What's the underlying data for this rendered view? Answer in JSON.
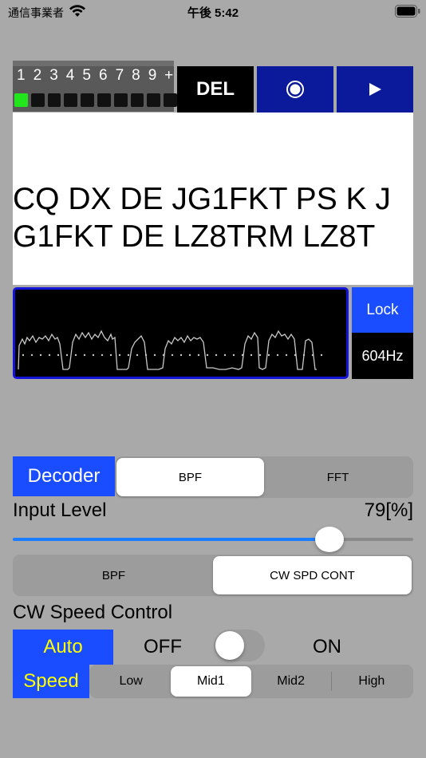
{
  "status_bar": {
    "carrier": "通信事業者",
    "time": "午後 5:42",
    "wifi_icon": "wifi-icon",
    "battery_icon": "battery-icon"
  },
  "channels": {
    "labels": [
      "1",
      "2",
      "3",
      "4",
      "5",
      "6",
      "7",
      "8",
      "9",
      "+"
    ],
    "active_index": 0,
    "active_color": "#22e61c"
  },
  "toolbar": {
    "del_label": "DEL",
    "record_icon": "record-icon",
    "play_icon": "play-icon",
    "accent_color": "#0a1a9a"
  },
  "decoded": {
    "text": "CQ DX DE JG1FKT PS K  JG1FKT DE LZ8TRM LZ8T"
  },
  "waveform": {
    "lock_label": "Lock",
    "frequency": "604Hz"
  },
  "decoder": {
    "label": "Decoder",
    "options": [
      "BPF",
      "FFT"
    ],
    "selected": "BPF"
  },
  "input_level": {
    "label": "Input Level",
    "value_text": "79[%]",
    "fraction": 0.79
  },
  "mode": {
    "options": [
      "BPF",
      "CW SPD CONT"
    ],
    "selected": "CW SPD CONT"
  },
  "cw_speed": {
    "section_label": "CW Speed Control",
    "auto_label": "Auto",
    "speed_label": "Speed",
    "off_label": "OFF",
    "on_label": "ON",
    "auto_on": false,
    "speed_options": [
      "Low",
      "Mid1",
      "Mid2",
      "High"
    ],
    "speed_selected": "Mid1"
  },
  "colors": {
    "background": "#a9a9a9",
    "blue_label": "#1a4dff",
    "auto_text": "#ffff00",
    "slider_fill": "#1a7cff"
  }
}
